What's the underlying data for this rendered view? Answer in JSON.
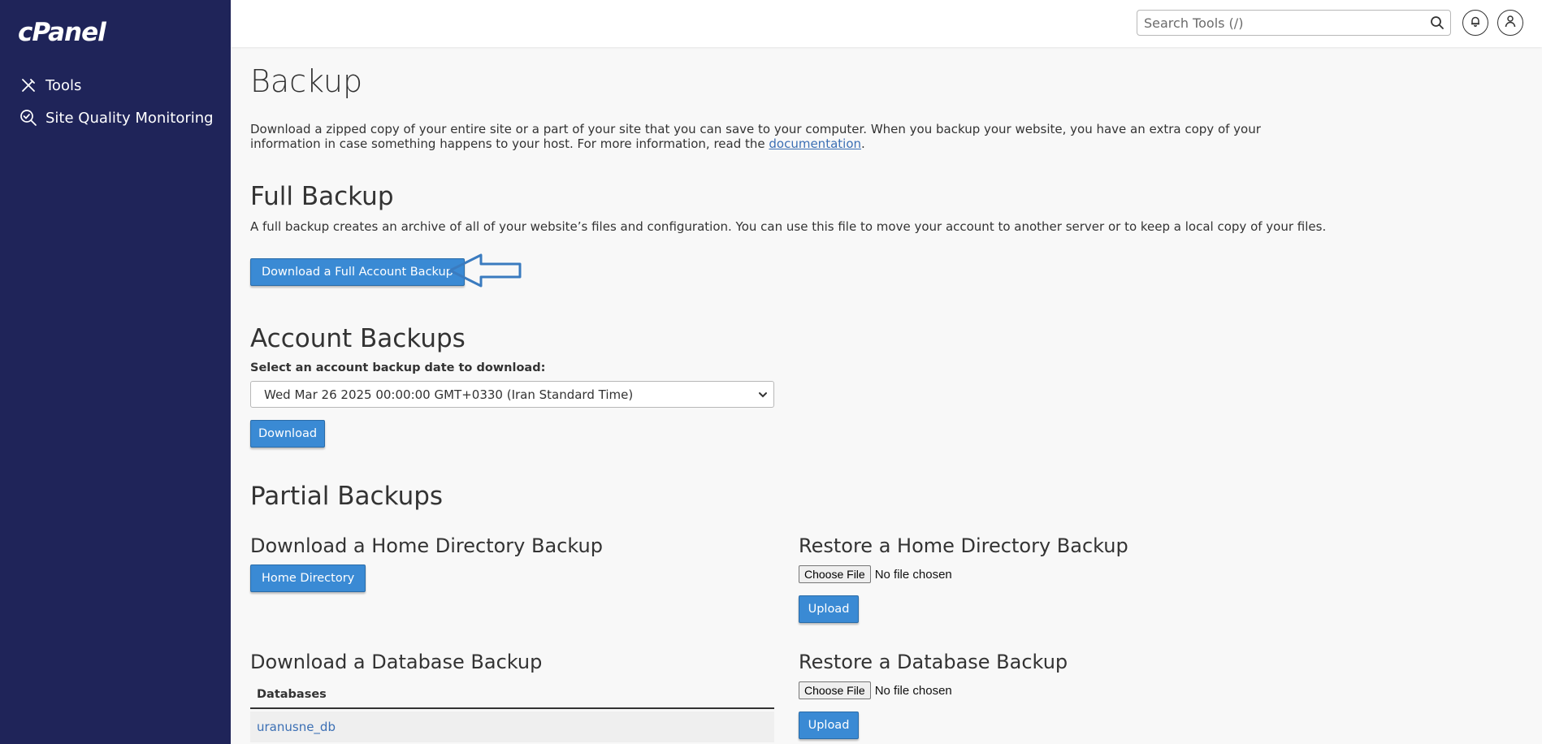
{
  "brand": {
    "logo_text": "cPanel"
  },
  "sidebar": {
    "items": [
      {
        "label": "Tools",
        "icon": "tools-icon"
      },
      {
        "label": "Site Quality Monitoring",
        "icon": "magnifier-check-icon"
      }
    ]
  },
  "header": {
    "search_placeholder": "Search Tools (/)",
    "icons": [
      "search-icon",
      "bell-icon",
      "user-icon"
    ]
  },
  "page": {
    "title": "Backup",
    "intro_text": "Download a zipped copy of your entire site or a part of your site that you can save to your computer. When you backup your website, you have an extra copy of your information in case something happens to your host. For more information, read the ",
    "intro_link": "documentation",
    "intro_end": "."
  },
  "full_backup": {
    "heading": "Full Backup",
    "description": "A full backup creates an archive of all of your website’s files and configuration. You can use this file to move your account to another server or to keep a local copy of your files.",
    "button": "Download a Full Account Backup"
  },
  "account_backups": {
    "heading": "Account Backups",
    "select_label": "Select an account backup date to download:",
    "selected_date": "Wed Mar 26 2025 00:00:00 GMT+0330 (Iran Standard Time)",
    "button": "Download"
  },
  "partial_backups": {
    "heading": "Partial Backups",
    "home_download_heading": "Download a Home Directory Backup",
    "home_button": "Home Directory",
    "home_restore_heading": "Restore a Home Directory Backup",
    "choose_file": "Choose File",
    "no_file": "No file chosen",
    "upload": "Upload",
    "db_download_heading": "Download a Database Backup",
    "db_table_header": "Databases",
    "databases": [
      "uranusne_db"
    ],
    "db_restore_heading": "Restore a Database Backup"
  },
  "colors": {
    "sidebar_bg": "#1f2459",
    "primary_button": "#3a8ad4",
    "arrow_annotation": "#3a7bbf"
  }
}
